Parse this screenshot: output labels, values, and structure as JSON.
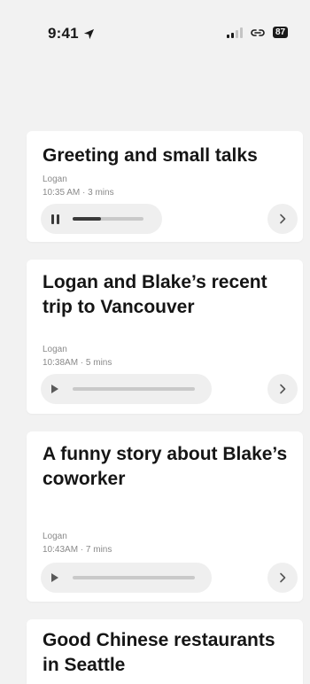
{
  "status": {
    "time": "9:41",
    "battery": "87"
  },
  "icons": {
    "location": "location-arrow-icon",
    "signal": "cellular-signal-icon",
    "link": "link-icon",
    "pause": "pause-icon",
    "play": "play-icon",
    "chevron": "chevron-right-icon"
  },
  "colors": {
    "background": "#f2f2f2",
    "card": "#ffffff",
    "accent": "#1a1a1a"
  },
  "conversations": [
    {
      "title": "Greeting and small talks",
      "speaker": "Logan",
      "time_duration": "10:35 AM · 3 mins",
      "state": "playing",
      "progress": 0.4
    },
    {
      "title": "Logan and Blake’s recent trip to Vancouver",
      "speaker": "Logan",
      "time_duration": "10:38AM · 5 mins",
      "state": "paused",
      "progress": 0
    },
    {
      "title": "A funny story about Blake’s coworker",
      "speaker": "Logan",
      "time_duration": "10:43AM · 7 mins",
      "state": "paused",
      "progress": 0
    },
    {
      "title": "Good Chinese restaurants in Seattle"
    }
  ]
}
